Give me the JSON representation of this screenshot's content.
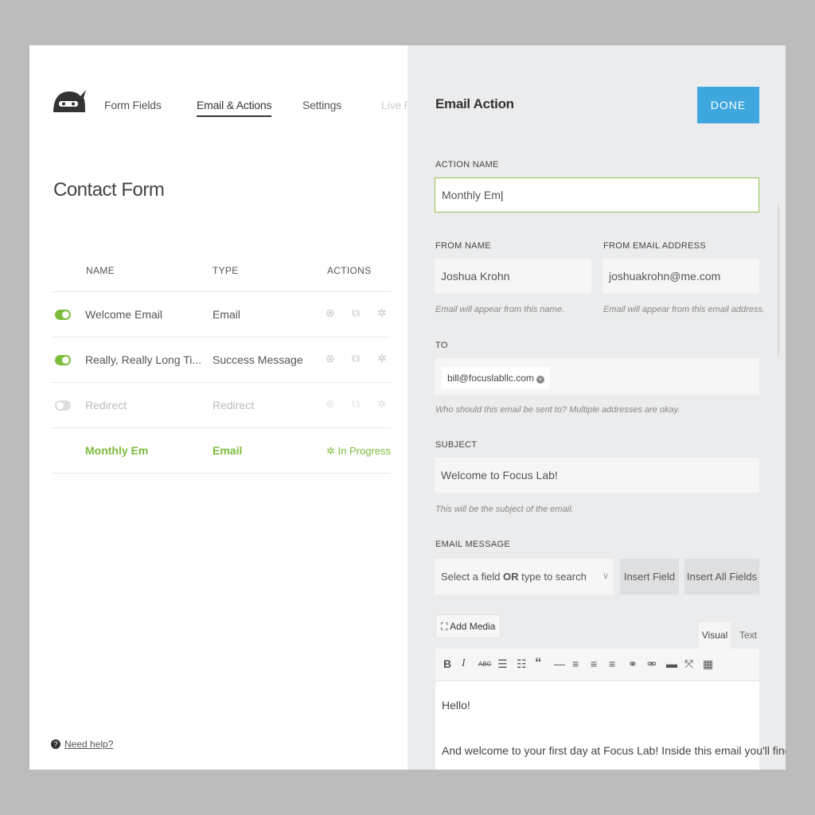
{
  "nav": {
    "form_fields": "Form Fields",
    "email_actions": "Email & Actions",
    "settings": "Settings",
    "live_preview": "Live Pr"
  },
  "page_title": "Contact Form",
  "table": {
    "headers": [
      "NAME",
      "TYPE",
      "ACTIONS"
    ],
    "rows": [
      {
        "name": "Welcome Email",
        "type": "Email",
        "enabled": true
      },
      {
        "name": "Really, Really Long Ti...",
        "type": "Success Message",
        "enabled": true
      },
      {
        "name": "Redirect",
        "type": "Redirect",
        "enabled": false
      },
      {
        "name": "Monthly Em",
        "type": "Email",
        "status": "In Progress"
      }
    ],
    "action_icons": [
      "close-circle-icon",
      "duplicate-icon",
      "gear-icon"
    ]
  },
  "help": "Need help?",
  "panel": {
    "title": "Email Action",
    "done": "DONE",
    "action_name_label": "ACTION NAME",
    "action_name_value": "Monthly Em",
    "from_name_label": "FROM NAME",
    "from_name_value": "Joshua Krohn",
    "from_name_hint": "Email will appear from this name.",
    "from_email_label": "FROM EMAIL ADDRESS",
    "from_email_value": "joshuakrohn@me.com",
    "from_email_hint": "Email will appear from this email address.",
    "to_label": "TO",
    "to_chip": "bill@focuslabllc.com",
    "to_hint": "Who should this email be sent to? Multiple addresses are okay.",
    "subject_label": "SUBJECT",
    "subject_value": "Welcome to Focus Lab!",
    "subject_hint": "This will be the subject of the email.",
    "message_label": "EMAIL MESSAGE",
    "select_prefix": "Select a field ",
    "select_bold": "OR",
    "select_suffix": " type to search",
    "insert_field": "Insert Field",
    "insert_all": "Insert All Fields",
    "add_media": "Add Media",
    "tab_visual": "Visual",
    "tab_text": "Text",
    "editor_line1": "Hello!",
    "editor_line2": "And welcome to your first day at Focus Lab! Inside this email you'll find"
  },
  "colors": {
    "accent_green": "#7cbd3c",
    "done_blue": "#3ea7de"
  }
}
